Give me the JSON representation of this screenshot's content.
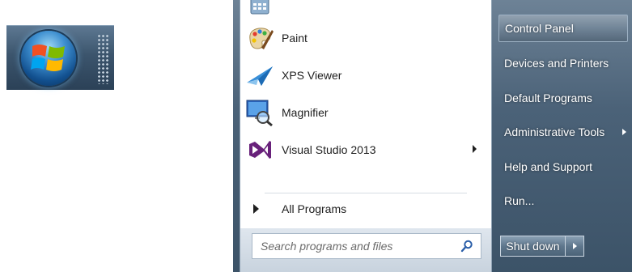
{
  "start_menu": {
    "programs": [
      {
        "label": "",
        "icon": "calculator-icon"
      },
      {
        "label": "Paint",
        "icon": "paint-icon"
      },
      {
        "label": "XPS Viewer",
        "icon": "xps-viewer-icon"
      },
      {
        "label": "Magnifier",
        "icon": "magnifier-icon"
      },
      {
        "label": "Visual Studio 2013",
        "icon": "visual-studio-icon",
        "has_submenu": true
      }
    ],
    "all_programs_label": "All Programs",
    "search": {
      "placeholder": "Search programs and files"
    },
    "right_items": [
      {
        "label": "Control Panel",
        "highlighted": true
      },
      {
        "label": "Devices and Printers"
      },
      {
        "label": "Default Programs"
      },
      {
        "label": "Administrative Tools",
        "has_submenu": true
      },
      {
        "label": "Help and Support"
      },
      {
        "label": "Run..."
      }
    ],
    "shutdown_label": "Shut down"
  },
  "taskbar": {
    "start_button_icon": "windows-orb-icon"
  },
  "colors": {
    "menu_frame": "#4b6278",
    "accent_purple": "#68217a",
    "text_dark": "#1e1e1e"
  }
}
